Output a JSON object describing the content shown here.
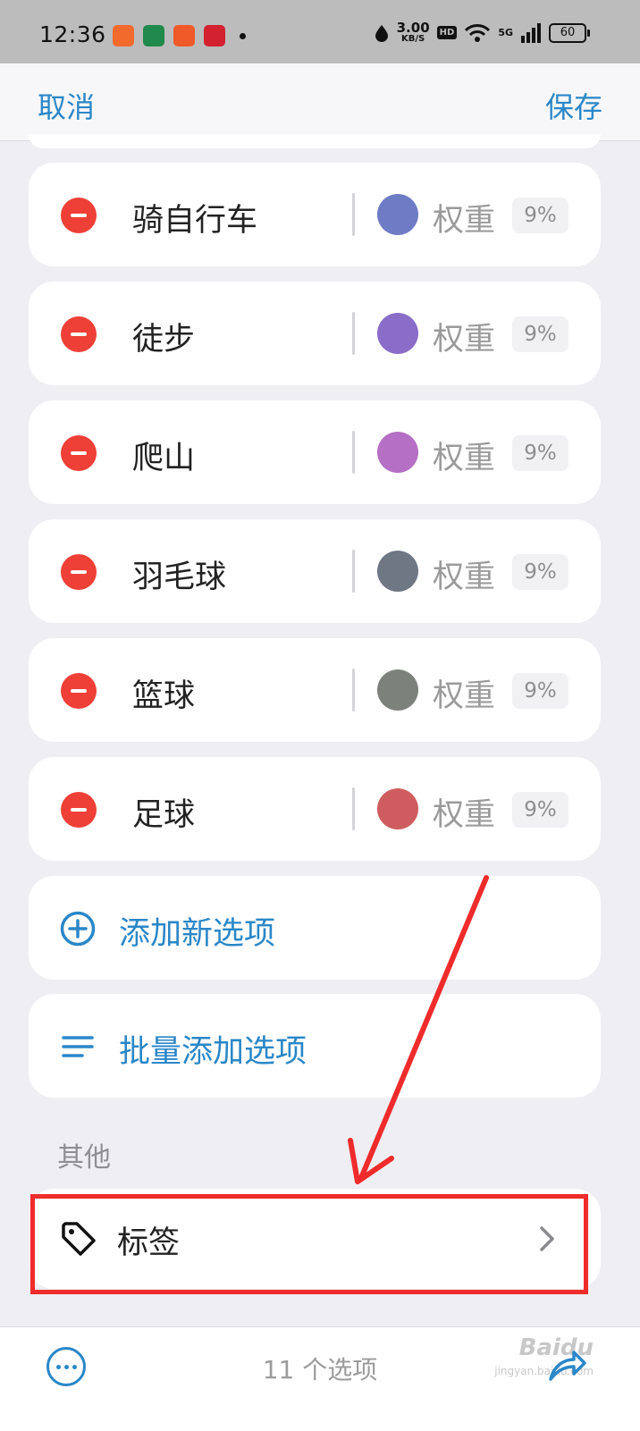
{
  "status_bar": {
    "time": "12:36",
    "net_speed": "3.00",
    "net_unit": "KB/S",
    "hd": "HD",
    "signal": "5G",
    "battery": "60"
  },
  "nav": {
    "cancel_label": "取消",
    "save_label": "保存"
  },
  "options": [
    {
      "label": "骑自行车",
      "color": "#6e7cc6",
      "weight_label": "权重",
      "weight": "9%"
    },
    {
      "label": "徒步",
      "color": "#8a6dc9",
      "weight_label": "权重",
      "weight": "9%"
    },
    {
      "label": "爬山",
      "color": "#b56fc4",
      "weight_label": "权重",
      "weight": "9%"
    },
    {
      "label": "羽毛球",
      "color": "#6f7684",
      "weight_label": "权重",
      "weight": "9%"
    },
    {
      "label": "篮球",
      "color": "#7d817c",
      "weight_label": "权重",
      "weight": "9%"
    },
    {
      "label": "足球",
      "color": "#cf5d5f",
      "weight_label": "权重",
      "weight": "9%"
    }
  ],
  "actions": {
    "add_label": "添加新选项",
    "batch_add_label": "批量添加选项"
  },
  "other": {
    "section_title": "其他",
    "tag_label": "标签"
  },
  "bottom_bar": {
    "count_label": "11 个选项"
  },
  "watermark": {
    "brand": "Baidu",
    "sub": "jingyan.baidu.com"
  },
  "colors": {
    "accent": "#2a87c8",
    "remove": "#ee4037",
    "highlight": "#ef2b2b"
  }
}
